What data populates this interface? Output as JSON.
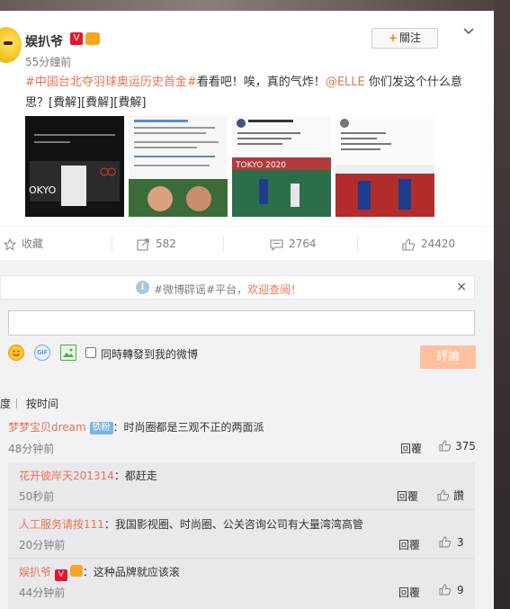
{
  "post": {
    "author": "娱扒爷",
    "time": "55分鐘前",
    "follow_label": "關注",
    "text": {
      "topic1": "#中国台北夺羽球奥运历史首金#",
      "part1": "看看吧！唉，真的气炸！",
      "mention": "@ELLE",
      "part2": " 你们发这个什么意思？[費解][費解][費解]"
    },
    "images": [
      "thumb-1",
      "thumb-2",
      "thumb-3",
      "thumb-4"
    ]
  },
  "actions": {
    "favorite": "收藏",
    "repost": "582",
    "comment": "2764",
    "like": "24420"
  },
  "notice": {
    "prefix": "#微博辟谣#平台，",
    "link": "欢迎查阅！",
    "close": "×"
  },
  "composer": {
    "repost_label": "同時轉發到我的微博",
    "submit_label": "評論"
  },
  "sort": {
    "hot": "度",
    "time": "按时间"
  },
  "comments": [
    {
      "name": "梦梦宝贝dream",
      "badge": "铁粉",
      "text": "：时尚圈都是三观不正的两面派",
      "time": "48分钟前",
      "reply": "回覆",
      "likes": "375"
    }
  ],
  "replies": [
    {
      "name": "花开彼岸天201314",
      "text": "：都赶走",
      "time": "50秒前",
      "reply": "回覆",
      "likes": "讚"
    },
    {
      "name": "人工服务请按111",
      "text": "：我国影视圈、时尚圈、公关咨询公司有大量湾湾高管",
      "time": "20分钟前",
      "reply": "回覆",
      "likes": "3"
    },
    {
      "name": "娱扒爷",
      "text": "：这种品牌就应该滚",
      "time": "44分钟前",
      "reply": "回覆",
      "likes": "9"
    }
  ],
  "colors": {
    "link": "#eb7350",
    "submit_disabled": "#ffc09f",
    "follow_plus": "#ff8200"
  }
}
